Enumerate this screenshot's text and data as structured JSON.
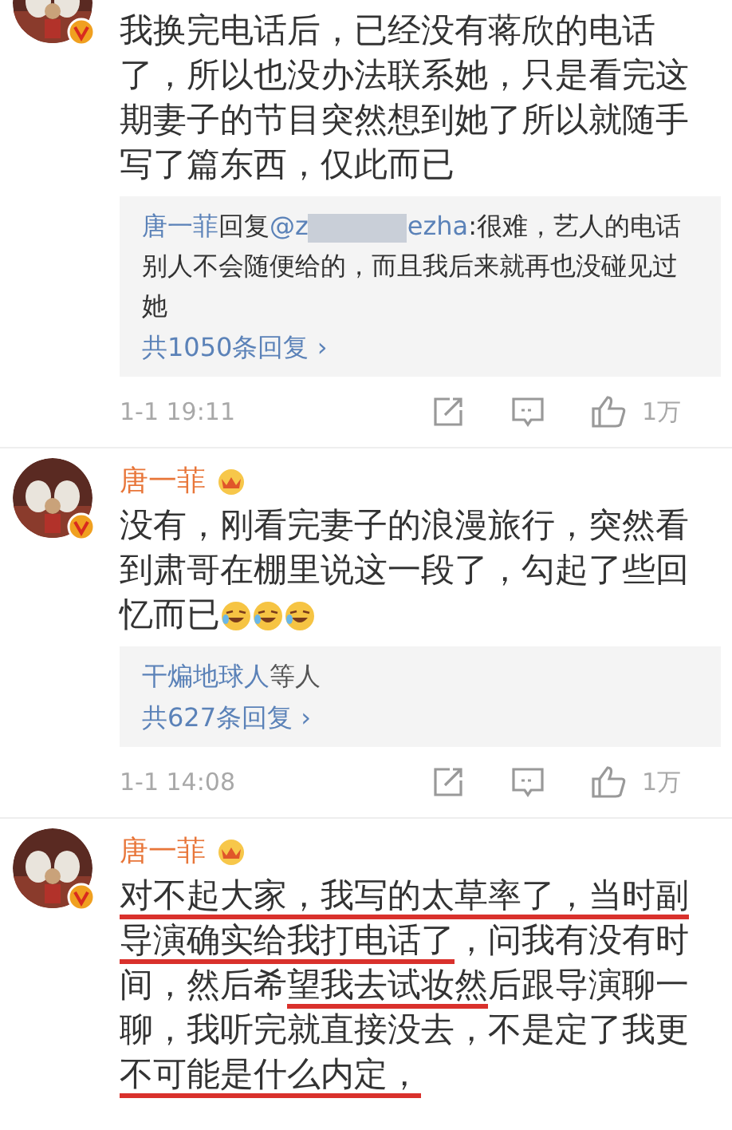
{
  "comments": [
    {
      "body": [
        {
          "text": "我换完电话后，已经没有蒋欣的电话了，所以也没办法联系她，只是看完这期妻子的节目突然想到她了所以就随手写了篇东西，仅此而已",
          "underlined": false
        }
      ],
      "reply": {
        "author": "唐一菲",
        "verb": "回复",
        "target_start": "@z",
        "redacted": true,
        "target_end": "ezha",
        "text": ":很难，艺人的电话别人不会随便给的，而且我后来就再也没碰见过她",
        "more": "共1050条回复",
        "chevron": "›"
      },
      "time": "1-1 19:11",
      "likes": "1万"
    },
    {
      "name": "唐一菲",
      "body": [
        {
          "text": "没有，刚看完妻子的浪漫旅行，突然看到肃哥在棚里说这一段了，勾起了些回忆而已",
          "underlined": false
        }
      ],
      "emojis": [
        {
          "kind": "laughing"
        },
        {
          "kind": "laughing"
        },
        {
          "kind": "laughing"
        }
      ],
      "reply": {
        "author": "干煸地球人",
        "verb": "等人",
        "more": "共627条回复",
        "chevron": "›"
      },
      "time": "1-1 14:08",
      "likes": "1万"
    },
    {
      "name": "唐一菲",
      "body": [
        {
          "text": "对不起大家，我写的太草率了，当时副导演确实给我打电话了",
          "underlined": true
        },
        {
          "text": "，问我有没有时间，然后希",
          "underlined": false
        },
        {
          "text": "望我去试妆然",
          "underlined": true
        },
        {
          "text": "后跟导演聊一聊，我听完就直接没去，不是定了我更",
          "underlined": false
        },
        {
          "text": "不可能是什么内定，",
          "underlined": true
        }
      ]
    }
  ]
}
